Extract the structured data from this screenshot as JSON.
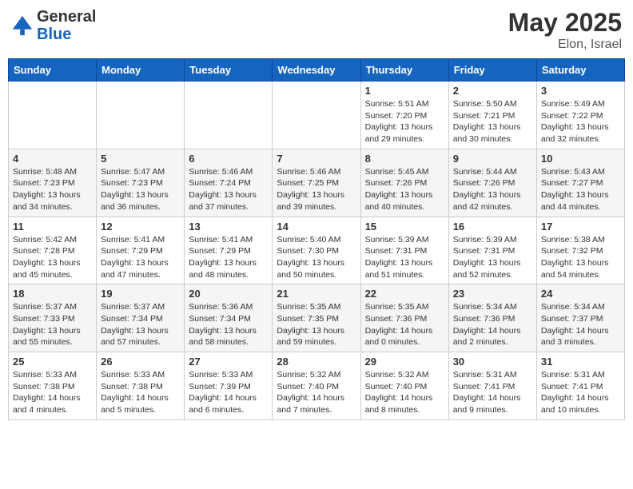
{
  "header": {
    "logo_general": "General",
    "logo_blue": "Blue",
    "month_title": "May 2025",
    "location": "Elon, Israel"
  },
  "weekdays": [
    "Sunday",
    "Monday",
    "Tuesday",
    "Wednesday",
    "Thursday",
    "Friday",
    "Saturday"
  ],
  "weeks": [
    [
      {
        "day": "",
        "info": ""
      },
      {
        "day": "",
        "info": ""
      },
      {
        "day": "",
        "info": ""
      },
      {
        "day": "",
        "info": ""
      },
      {
        "day": "1",
        "info": "Sunrise: 5:51 AM\nSunset: 7:20 PM\nDaylight: 13 hours\nand 29 minutes."
      },
      {
        "day": "2",
        "info": "Sunrise: 5:50 AM\nSunset: 7:21 PM\nDaylight: 13 hours\nand 30 minutes."
      },
      {
        "day": "3",
        "info": "Sunrise: 5:49 AM\nSunset: 7:22 PM\nDaylight: 13 hours\nand 32 minutes."
      }
    ],
    [
      {
        "day": "4",
        "info": "Sunrise: 5:48 AM\nSunset: 7:23 PM\nDaylight: 13 hours\nand 34 minutes."
      },
      {
        "day": "5",
        "info": "Sunrise: 5:47 AM\nSunset: 7:23 PM\nDaylight: 13 hours\nand 36 minutes."
      },
      {
        "day": "6",
        "info": "Sunrise: 5:46 AM\nSunset: 7:24 PM\nDaylight: 13 hours\nand 37 minutes."
      },
      {
        "day": "7",
        "info": "Sunrise: 5:46 AM\nSunset: 7:25 PM\nDaylight: 13 hours\nand 39 minutes."
      },
      {
        "day": "8",
        "info": "Sunrise: 5:45 AM\nSunset: 7:26 PM\nDaylight: 13 hours\nand 40 minutes."
      },
      {
        "day": "9",
        "info": "Sunrise: 5:44 AM\nSunset: 7:26 PM\nDaylight: 13 hours\nand 42 minutes."
      },
      {
        "day": "10",
        "info": "Sunrise: 5:43 AM\nSunset: 7:27 PM\nDaylight: 13 hours\nand 44 minutes."
      }
    ],
    [
      {
        "day": "11",
        "info": "Sunrise: 5:42 AM\nSunset: 7:28 PM\nDaylight: 13 hours\nand 45 minutes."
      },
      {
        "day": "12",
        "info": "Sunrise: 5:41 AM\nSunset: 7:29 PM\nDaylight: 13 hours\nand 47 minutes."
      },
      {
        "day": "13",
        "info": "Sunrise: 5:41 AM\nSunset: 7:29 PM\nDaylight: 13 hours\nand 48 minutes."
      },
      {
        "day": "14",
        "info": "Sunrise: 5:40 AM\nSunset: 7:30 PM\nDaylight: 13 hours\nand 50 minutes."
      },
      {
        "day": "15",
        "info": "Sunrise: 5:39 AM\nSunset: 7:31 PM\nDaylight: 13 hours\nand 51 minutes."
      },
      {
        "day": "16",
        "info": "Sunrise: 5:39 AM\nSunset: 7:31 PM\nDaylight: 13 hours\nand 52 minutes."
      },
      {
        "day": "17",
        "info": "Sunrise: 5:38 AM\nSunset: 7:32 PM\nDaylight: 13 hours\nand 54 minutes."
      }
    ],
    [
      {
        "day": "18",
        "info": "Sunrise: 5:37 AM\nSunset: 7:33 PM\nDaylight: 13 hours\nand 55 minutes."
      },
      {
        "day": "19",
        "info": "Sunrise: 5:37 AM\nSunset: 7:34 PM\nDaylight: 13 hours\nand 57 minutes."
      },
      {
        "day": "20",
        "info": "Sunrise: 5:36 AM\nSunset: 7:34 PM\nDaylight: 13 hours\nand 58 minutes."
      },
      {
        "day": "21",
        "info": "Sunrise: 5:35 AM\nSunset: 7:35 PM\nDaylight: 13 hours\nand 59 minutes."
      },
      {
        "day": "22",
        "info": "Sunrise: 5:35 AM\nSunset: 7:36 PM\nDaylight: 14 hours\nand 0 minutes."
      },
      {
        "day": "23",
        "info": "Sunrise: 5:34 AM\nSunset: 7:36 PM\nDaylight: 14 hours\nand 2 minutes."
      },
      {
        "day": "24",
        "info": "Sunrise: 5:34 AM\nSunset: 7:37 PM\nDaylight: 14 hours\nand 3 minutes."
      }
    ],
    [
      {
        "day": "25",
        "info": "Sunrise: 5:33 AM\nSunset: 7:38 PM\nDaylight: 14 hours\nand 4 minutes."
      },
      {
        "day": "26",
        "info": "Sunrise: 5:33 AM\nSunset: 7:38 PM\nDaylight: 14 hours\nand 5 minutes."
      },
      {
        "day": "27",
        "info": "Sunrise: 5:33 AM\nSunset: 7:39 PM\nDaylight: 14 hours\nand 6 minutes."
      },
      {
        "day": "28",
        "info": "Sunrise: 5:32 AM\nSunset: 7:40 PM\nDaylight: 14 hours\nand 7 minutes."
      },
      {
        "day": "29",
        "info": "Sunrise: 5:32 AM\nSunset: 7:40 PM\nDaylight: 14 hours\nand 8 minutes."
      },
      {
        "day": "30",
        "info": "Sunrise: 5:31 AM\nSunset: 7:41 PM\nDaylight: 14 hours\nand 9 minutes."
      },
      {
        "day": "31",
        "info": "Sunrise: 5:31 AM\nSunset: 7:41 PM\nDaylight: 14 hours\nand 10 minutes."
      }
    ]
  ]
}
